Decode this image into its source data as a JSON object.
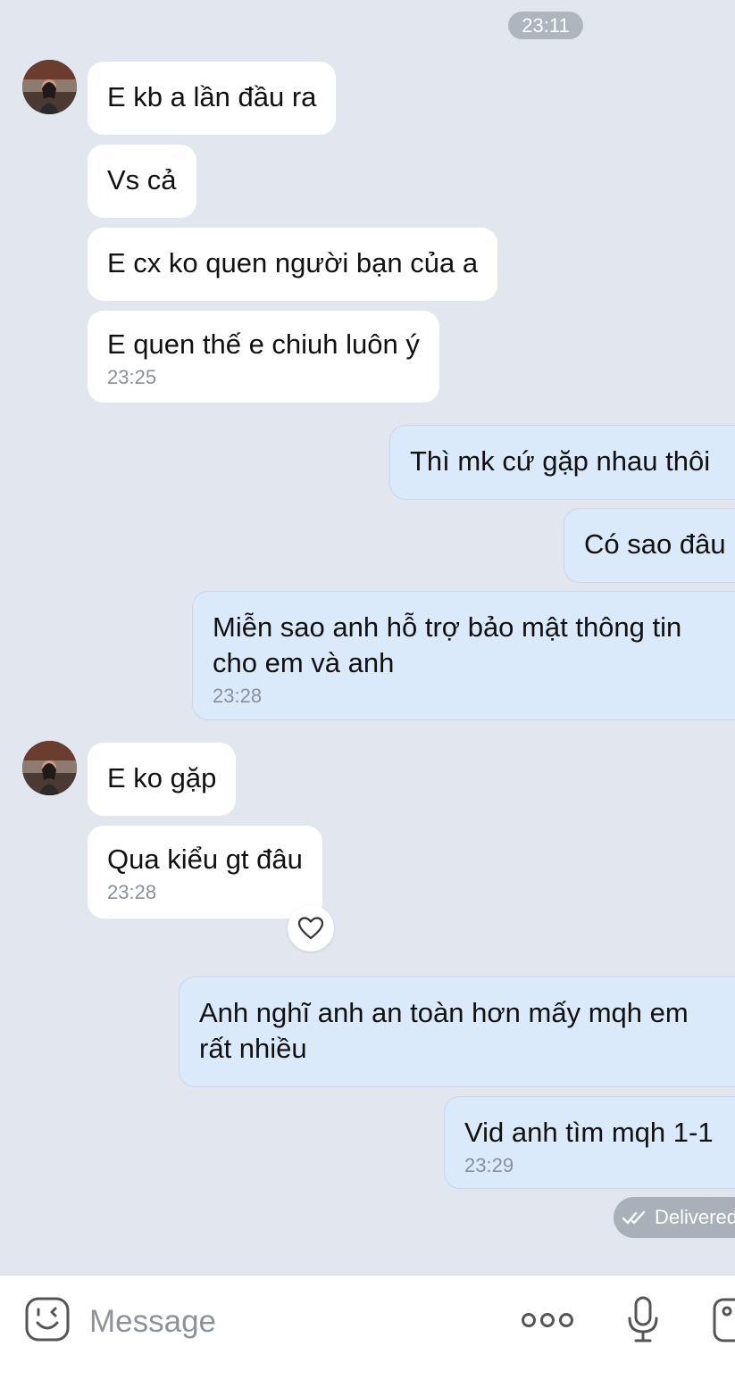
{
  "header_time": "23:11",
  "messages": [
    {
      "text": "E kb a lần đầu ra"
    },
    {
      "text": "Vs cả"
    },
    {
      "text": "E cx ko quen người bạn của a"
    },
    {
      "text": "E quen thế e chiuh luôn ý",
      "time": "23:25"
    },
    {
      "text": "Thì mk cứ gặp nhau thôi"
    },
    {
      "text": "Có sao đâu"
    },
    {
      "line1": "Miễn sao anh hỗ trợ bảo mật thông tin",
      "line2": "cho em và anh",
      "time": "23:28"
    },
    {
      "text": "E ko gặp"
    },
    {
      "text": "Qua kiểu gt đâu",
      "time": "23:28"
    },
    {
      "line1": "Anh nghĩ anh an toàn hơn mấy mqh em",
      "line2": "rất nhiều"
    },
    {
      "text": "Vid anh tìm mqh 1-1",
      "time": "23:29"
    }
  ],
  "status": "Delivered",
  "composer": {
    "placeholder": "Message"
  },
  "icons": {
    "emoji": "emoji-icon",
    "more": "more-dots-icon",
    "mic": "microphone-icon",
    "photo": "photo-icon",
    "heart": "heart-icon",
    "check": "double-check-icon"
  },
  "colors": {
    "background": "#e2e7ef",
    "incoming_bubble": "#ffffff",
    "outgoing_bubble": "#dbeafb",
    "pill": "#aeb5bf"
  }
}
